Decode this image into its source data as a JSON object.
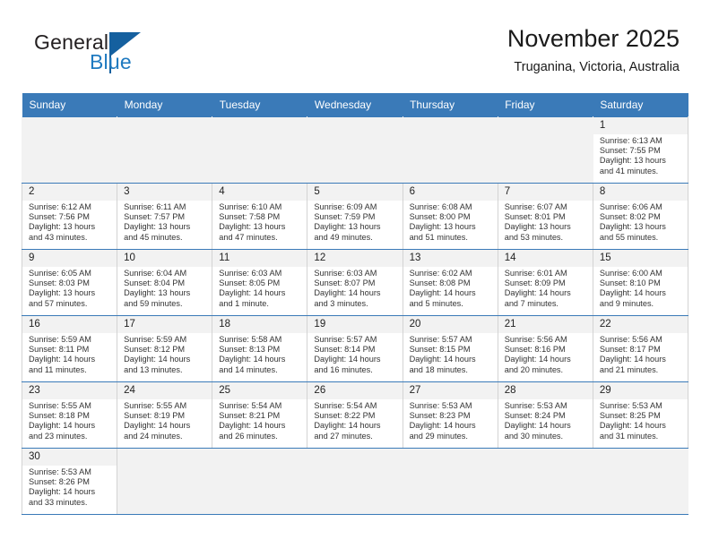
{
  "brand": {
    "name_part1": "General",
    "name_part2": "Blue",
    "triangle_icon": "blue-triangle-logo-icon",
    "accent_color": "#1f7ac0"
  },
  "header": {
    "title": "November 2025",
    "subtitle": "Truganina, Victoria, Australia"
  },
  "theme": {
    "header_bg": "#3a7ab8",
    "header_text": "#ffffff",
    "daynum_bg": "#f2f2f2",
    "empty_cell_bg": "#f2f2f2",
    "grid_line": "#3a7ab8"
  },
  "weekdays": [
    "Sunday",
    "Monday",
    "Tuesday",
    "Wednesday",
    "Thursday",
    "Friday",
    "Saturday"
  ],
  "weeks": [
    [
      {
        "empty": true
      },
      {
        "empty": true
      },
      {
        "empty": true
      },
      {
        "empty": true
      },
      {
        "empty": true
      },
      {
        "empty": true
      },
      {
        "day": "1",
        "sunrise": "Sunrise: 6:13 AM",
        "sunset": "Sunset: 7:55 PM",
        "daylight_line1": "Daylight: 13 hours",
        "daylight_line2": "and 41 minutes."
      }
    ],
    [
      {
        "day": "2",
        "sunrise": "Sunrise: 6:12 AM",
        "sunset": "Sunset: 7:56 PM",
        "daylight_line1": "Daylight: 13 hours",
        "daylight_line2": "and 43 minutes."
      },
      {
        "day": "3",
        "sunrise": "Sunrise: 6:11 AM",
        "sunset": "Sunset: 7:57 PM",
        "daylight_line1": "Daylight: 13 hours",
        "daylight_line2": "and 45 minutes."
      },
      {
        "day": "4",
        "sunrise": "Sunrise: 6:10 AM",
        "sunset": "Sunset: 7:58 PM",
        "daylight_line1": "Daylight: 13 hours",
        "daylight_line2": "and 47 minutes."
      },
      {
        "day": "5",
        "sunrise": "Sunrise: 6:09 AM",
        "sunset": "Sunset: 7:59 PM",
        "daylight_line1": "Daylight: 13 hours",
        "daylight_line2": "and 49 minutes."
      },
      {
        "day": "6",
        "sunrise": "Sunrise: 6:08 AM",
        "sunset": "Sunset: 8:00 PM",
        "daylight_line1": "Daylight: 13 hours",
        "daylight_line2": "and 51 minutes."
      },
      {
        "day": "7",
        "sunrise": "Sunrise: 6:07 AM",
        "sunset": "Sunset: 8:01 PM",
        "daylight_line1": "Daylight: 13 hours",
        "daylight_line2": "and 53 minutes."
      },
      {
        "day": "8",
        "sunrise": "Sunrise: 6:06 AM",
        "sunset": "Sunset: 8:02 PM",
        "daylight_line1": "Daylight: 13 hours",
        "daylight_line2": "and 55 minutes."
      }
    ],
    [
      {
        "day": "9",
        "sunrise": "Sunrise: 6:05 AM",
        "sunset": "Sunset: 8:03 PM",
        "daylight_line1": "Daylight: 13 hours",
        "daylight_line2": "and 57 minutes."
      },
      {
        "day": "10",
        "sunrise": "Sunrise: 6:04 AM",
        "sunset": "Sunset: 8:04 PM",
        "daylight_line1": "Daylight: 13 hours",
        "daylight_line2": "and 59 minutes."
      },
      {
        "day": "11",
        "sunrise": "Sunrise: 6:03 AM",
        "sunset": "Sunset: 8:05 PM",
        "daylight_line1": "Daylight: 14 hours",
        "daylight_line2": "and 1 minute."
      },
      {
        "day": "12",
        "sunrise": "Sunrise: 6:03 AM",
        "sunset": "Sunset: 8:07 PM",
        "daylight_line1": "Daylight: 14 hours",
        "daylight_line2": "and 3 minutes."
      },
      {
        "day": "13",
        "sunrise": "Sunrise: 6:02 AM",
        "sunset": "Sunset: 8:08 PM",
        "daylight_line1": "Daylight: 14 hours",
        "daylight_line2": "and 5 minutes."
      },
      {
        "day": "14",
        "sunrise": "Sunrise: 6:01 AM",
        "sunset": "Sunset: 8:09 PM",
        "daylight_line1": "Daylight: 14 hours",
        "daylight_line2": "and 7 minutes."
      },
      {
        "day": "15",
        "sunrise": "Sunrise: 6:00 AM",
        "sunset": "Sunset: 8:10 PM",
        "daylight_line1": "Daylight: 14 hours",
        "daylight_line2": "and 9 minutes."
      }
    ],
    [
      {
        "day": "16",
        "sunrise": "Sunrise: 5:59 AM",
        "sunset": "Sunset: 8:11 PM",
        "daylight_line1": "Daylight: 14 hours",
        "daylight_line2": "and 11 minutes."
      },
      {
        "day": "17",
        "sunrise": "Sunrise: 5:59 AM",
        "sunset": "Sunset: 8:12 PM",
        "daylight_line1": "Daylight: 14 hours",
        "daylight_line2": "and 13 minutes."
      },
      {
        "day": "18",
        "sunrise": "Sunrise: 5:58 AM",
        "sunset": "Sunset: 8:13 PM",
        "daylight_line1": "Daylight: 14 hours",
        "daylight_line2": "and 14 minutes."
      },
      {
        "day": "19",
        "sunrise": "Sunrise: 5:57 AM",
        "sunset": "Sunset: 8:14 PM",
        "daylight_line1": "Daylight: 14 hours",
        "daylight_line2": "and 16 minutes."
      },
      {
        "day": "20",
        "sunrise": "Sunrise: 5:57 AM",
        "sunset": "Sunset: 8:15 PM",
        "daylight_line1": "Daylight: 14 hours",
        "daylight_line2": "and 18 minutes."
      },
      {
        "day": "21",
        "sunrise": "Sunrise: 5:56 AM",
        "sunset": "Sunset: 8:16 PM",
        "daylight_line1": "Daylight: 14 hours",
        "daylight_line2": "and 20 minutes."
      },
      {
        "day": "22",
        "sunrise": "Sunrise: 5:56 AM",
        "sunset": "Sunset: 8:17 PM",
        "daylight_line1": "Daylight: 14 hours",
        "daylight_line2": "and 21 minutes."
      }
    ],
    [
      {
        "day": "23",
        "sunrise": "Sunrise: 5:55 AM",
        "sunset": "Sunset: 8:18 PM",
        "daylight_line1": "Daylight: 14 hours",
        "daylight_line2": "and 23 minutes."
      },
      {
        "day": "24",
        "sunrise": "Sunrise: 5:55 AM",
        "sunset": "Sunset: 8:19 PM",
        "daylight_line1": "Daylight: 14 hours",
        "daylight_line2": "and 24 minutes."
      },
      {
        "day": "25",
        "sunrise": "Sunrise: 5:54 AM",
        "sunset": "Sunset: 8:21 PM",
        "daylight_line1": "Daylight: 14 hours",
        "daylight_line2": "and 26 minutes."
      },
      {
        "day": "26",
        "sunrise": "Sunrise: 5:54 AM",
        "sunset": "Sunset: 8:22 PM",
        "daylight_line1": "Daylight: 14 hours",
        "daylight_line2": "and 27 minutes."
      },
      {
        "day": "27",
        "sunrise": "Sunrise: 5:53 AM",
        "sunset": "Sunset: 8:23 PM",
        "daylight_line1": "Daylight: 14 hours",
        "daylight_line2": "and 29 minutes."
      },
      {
        "day": "28",
        "sunrise": "Sunrise: 5:53 AM",
        "sunset": "Sunset: 8:24 PM",
        "daylight_line1": "Daylight: 14 hours",
        "daylight_line2": "and 30 minutes."
      },
      {
        "day": "29",
        "sunrise": "Sunrise: 5:53 AM",
        "sunset": "Sunset: 8:25 PM",
        "daylight_line1": "Daylight: 14 hours",
        "daylight_line2": "and 31 minutes."
      }
    ],
    [
      {
        "day": "30",
        "sunrise": "Sunrise: 5:53 AM",
        "sunset": "Sunset: 8:26 PM",
        "daylight_line1": "Daylight: 14 hours",
        "daylight_line2": "and 33 minutes."
      },
      {
        "empty": true
      },
      {
        "empty": true
      },
      {
        "empty": true
      },
      {
        "empty": true
      },
      {
        "empty": true
      },
      {
        "empty": true
      }
    ]
  ]
}
